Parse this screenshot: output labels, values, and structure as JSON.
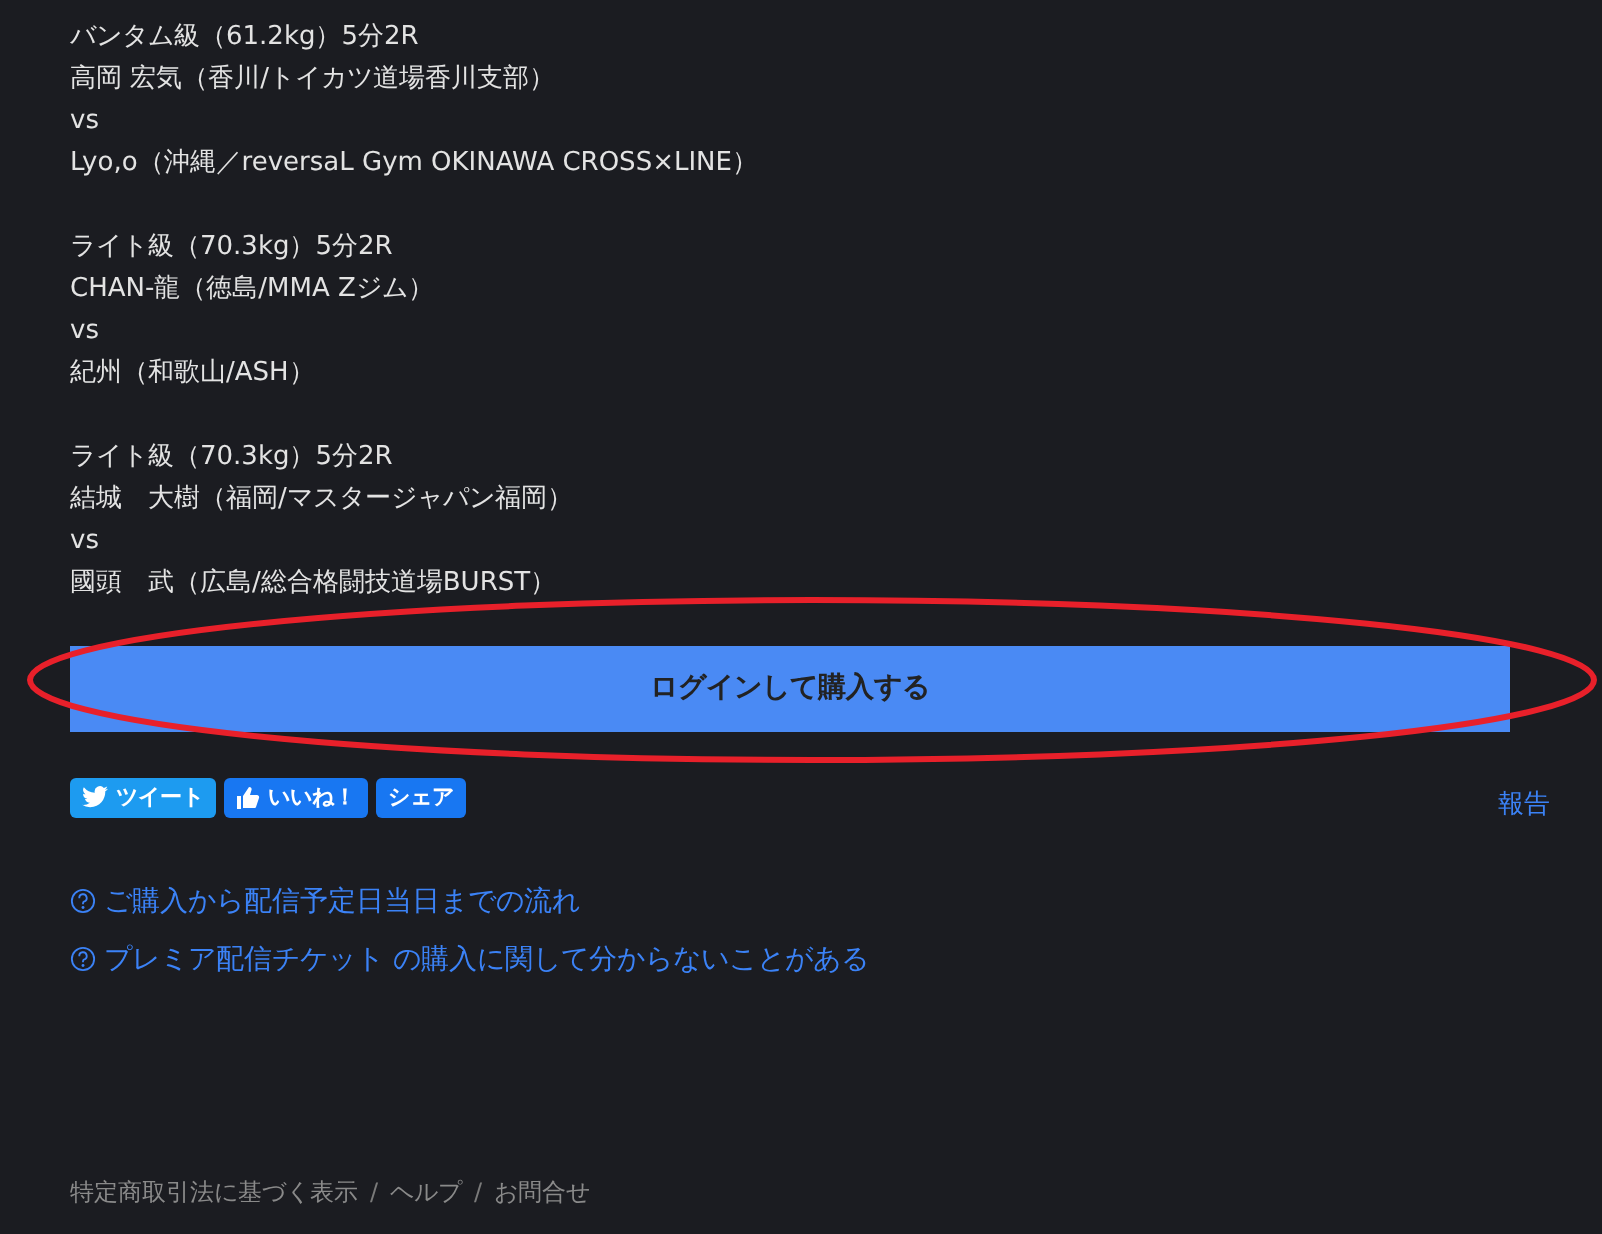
{
  "matches": [
    {
      "title": "バンタム級（61.2kg）5分2R",
      "fighter_a": "高岡 宏気（香川/トイカツ道場香川支部）",
      "vs": "vs",
      "fighter_b": "Lyo,o（沖縄／reversaL Gym OKINAWA CROSS×LINE）"
    },
    {
      "title": "ライト級（70.3kg）5分2R",
      "fighter_a": "CHAN-龍（徳島/MMA Zジム）",
      "vs": "vs",
      "fighter_b": "紀州（和歌山/ASH）"
    },
    {
      "title": "ライト級（70.3kg）5分2R",
      "fighter_a": "結城　大樹（福岡/マスタージャパン福岡）",
      "vs": "vs",
      "fighter_b": "國頭　武（広島/総合格闘技道場BURST）"
    }
  ],
  "purchase_button": "ログインして購入する",
  "share_buttons": [
    {
      "kind": "tweet",
      "label": "ツイート"
    },
    {
      "kind": "like",
      "label": "いいね！"
    },
    {
      "kind": "share",
      "label": "シェア"
    }
  ],
  "report_link": "報告",
  "help_links": [
    "ご購入から配信予定日当日までの流れ",
    "プレミア配信チケット の購入に関して分からないことがある"
  ],
  "footer": [
    {
      "kind": "link",
      "text": "特定商取引法に基づく表示"
    },
    {
      "kind": "separator",
      "text": "/"
    },
    {
      "kind": "link",
      "text": "ヘルプ"
    },
    {
      "kind": "separator",
      "text": "/"
    },
    {
      "kind": "link",
      "text": "お問合せ"
    }
  ]
}
